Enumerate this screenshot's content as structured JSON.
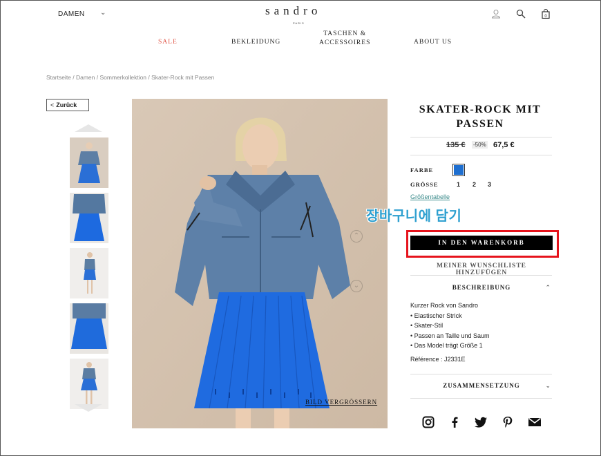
{
  "header": {
    "language": "DAMEN",
    "logo": "sandro",
    "logo_sub": "PARIS",
    "nav": [
      {
        "label": "SALE"
      },
      {
        "label": "BEKLEIDUNG"
      },
      {
        "label_line1": "TASCHEN &",
        "label_line2": "ACCESSOIRES"
      },
      {
        "label": "ABOUT US"
      }
    ]
  },
  "breadcrumb": "Startseite / Damen / Sommerkollektion / Skater-Rock mit Passen",
  "back_label": "Zurück",
  "thumbnails": [
    "look-front",
    "jacket-top",
    "side-view",
    "skirt-close",
    "full-front"
  ],
  "main_image": {
    "enlarge_label": "BILD VERGRÖSSERN"
  },
  "product": {
    "title_line1": "SKATER-ROCK MIT",
    "title_line2": "PASSEN",
    "price_old": "135 €",
    "discount": "-50%",
    "price_new": "67,5 €",
    "color_label": "FARBE",
    "color_swatch": "#1e6fd0",
    "size_label": "GRÖSSE",
    "sizes": [
      "1",
      "2",
      "3"
    ],
    "size_chart": "Größentabelle",
    "cart_button": "IN DEN WARENKORB",
    "wishlist": "MEINER WUNSCHLISTE HINZUFÜGEN",
    "description_title": "BESCHREIBUNG",
    "description": [
      "Kurzer Rock von Sandro",
      "• Elastischer Strick",
      "• Skater-Stil",
      "• Passen an Taille und Saum",
      "• Das Model trägt Größe 1"
    ],
    "reference": "Référence : J2331E",
    "composition_title": "ZUSAMMENSETZUNG"
  },
  "overlay": {
    "annotation_text": "장바구니에 담기",
    "annotation_color": "#2ea0d0",
    "highlight_color": "#e6131c"
  },
  "social": [
    "instagram-icon",
    "facebook-icon",
    "twitter-icon",
    "pinterest-icon",
    "mail-icon"
  ]
}
